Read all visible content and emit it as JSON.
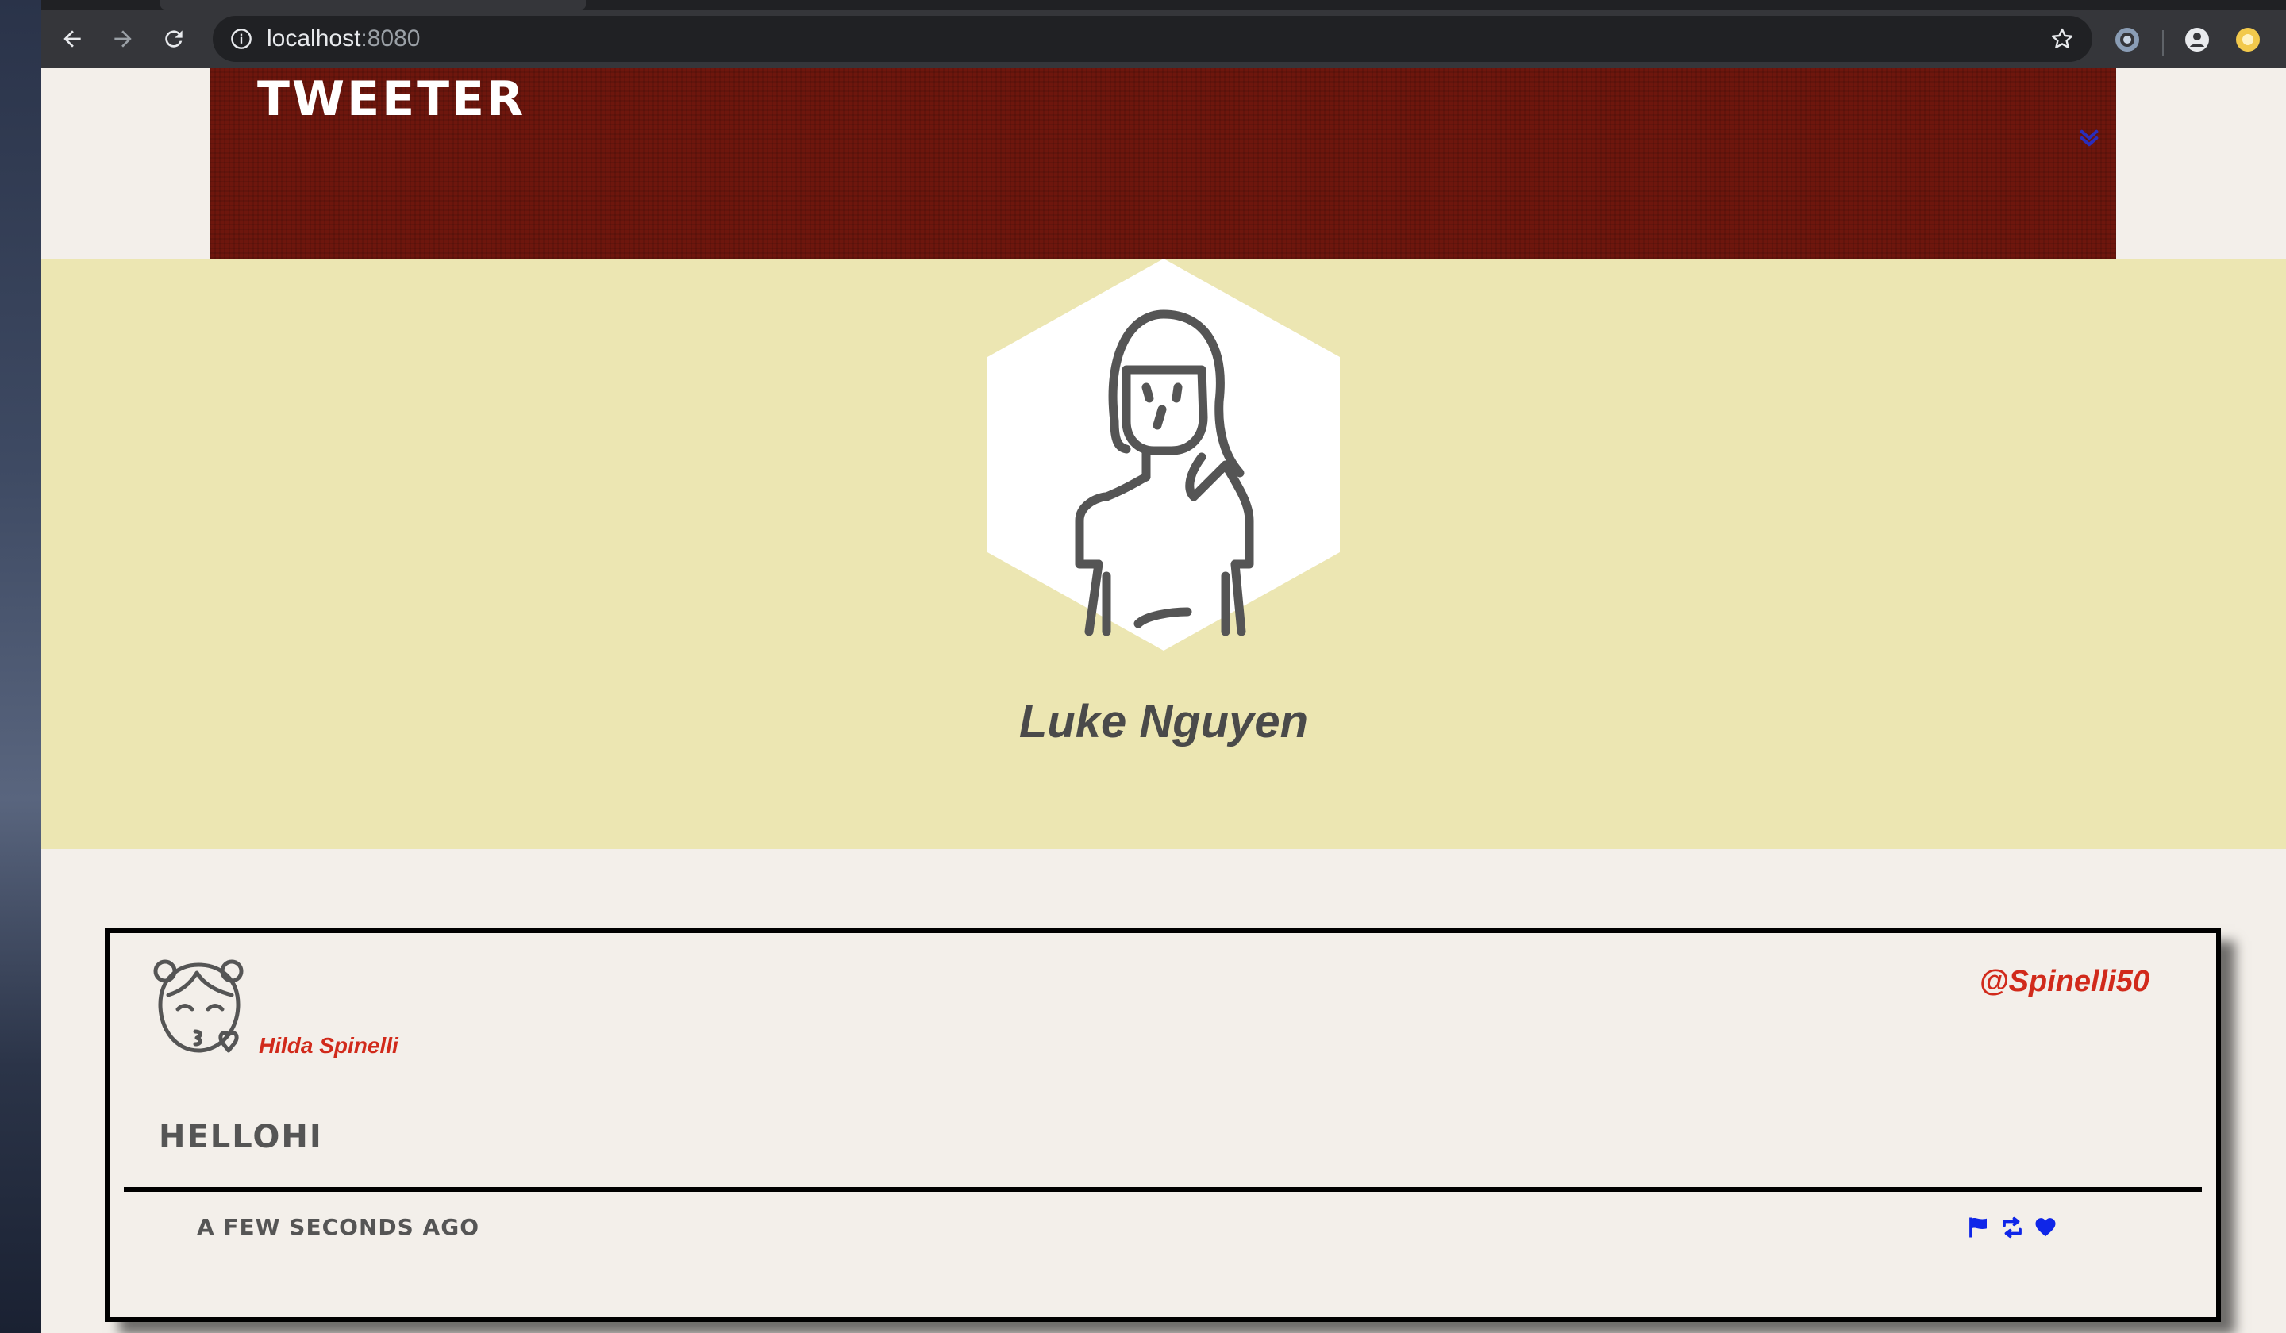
{
  "browser": {
    "url_host": "localhost",
    "url_port": ":8080",
    "icons": [
      "back-icon",
      "forward-icon",
      "reload-icon",
      "info-icon",
      "star-icon",
      "extension-icon",
      "profile-icon",
      "extension-icon"
    ]
  },
  "header": {
    "brand": "TWEETER",
    "toggle_icon": "chevron-down-icon",
    "background_color": "#6e160d"
  },
  "profile": {
    "name": "Luke Nguyen",
    "background_color": "#ece6b2"
  },
  "tweet": {
    "author_name": "Hilda Spinelli",
    "handle": "@Spinelli50",
    "text": "HELLOHI",
    "time": "A FEW SECONDS AGO",
    "actions": [
      "flag-icon",
      "retweet-icon",
      "heart-icon"
    ],
    "accent_color": "#d12a1b",
    "action_color": "#0f26e8"
  }
}
